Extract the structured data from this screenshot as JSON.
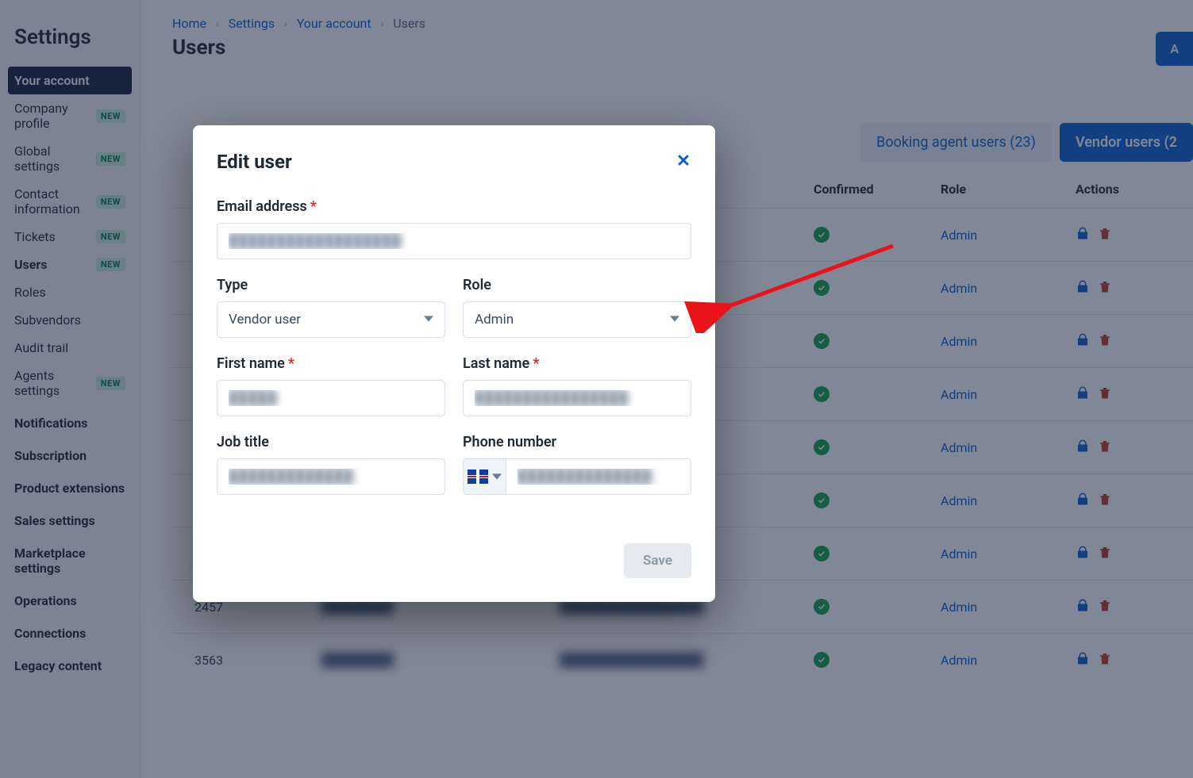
{
  "sidebar": {
    "title": "Settings",
    "active_group_label": "Your account",
    "items": [
      {
        "label": "Company profile",
        "new": true,
        "bold": false
      },
      {
        "label": "Global settings",
        "new": true,
        "bold": false
      },
      {
        "label": "Contact information",
        "new": true,
        "bold": false
      },
      {
        "label": "Tickets",
        "new": true,
        "bold": false
      },
      {
        "label": "Users",
        "new": true,
        "bold": true
      },
      {
        "label": "Roles",
        "new": false,
        "bold": false
      },
      {
        "label": "Subvendors",
        "new": false,
        "bold": false
      },
      {
        "label": "Audit trail",
        "new": false,
        "bold": false
      },
      {
        "label": "Agents settings",
        "new": true,
        "bold": false
      }
    ],
    "groups": [
      "Notifications",
      "Subscription",
      "Product extensions",
      "Sales settings",
      "Marketplace settings",
      "Operations",
      "Connections",
      "Legacy content"
    ],
    "new_badge_text": "NEW"
  },
  "breadcrumb": {
    "items": [
      "Home",
      "Settings",
      "Your account",
      "Users"
    ]
  },
  "page": {
    "title": "Users",
    "add_button": "A",
    "tabs": {
      "booking_agent": "Booking agent users (23)",
      "vendor": "Vendor users (2"
    }
  },
  "table": {
    "headers": {
      "id": "",
      "name": "",
      "email": "",
      "confirmed": "Confirmed",
      "role": "Role",
      "actions": "Actions"
    },
    "role_label": "Admin",
    "rows": [
      {
        "id": "",
        "name": "████████",
        "email": "████████████████"
      },
      {
        "id": "",
        "name": "████████",
        "email": "████████████████"
      },
      {
        "id": "",
        "name": "████████",
        "email": "████████████████"
      },
      {
        "id": "",
        "name": "████████",
        "email": "████████████████"
      },
      {
        "id": "",
        "name": "████████",
        "email": "████████████████"
      },
      {
        "id": "",
        "name": "████████",
        "email": "████████████████"
      },
      {
        "id": "",
        "name": "████████",
        "email": "████████████████"
      },
      {
        "id": "2457",
        "name": "████████",
        "email": "████████████████"
      },
      {
        "id": "3563",
        "name": "████████",
        "email": "████████████████"
      }
    ]
  },
  "dialog": {
    "title": "Edit user",
    "labels": {
      "email": "Email address",
      "type": "Type",
      "role": "Role",
      "first_name": "First name",
      "last_name": "Last name",
      "job_title": "Job title",
      "phone": "Phone number"
    },
    "values": {
      "email": "██████████████████",
      "type": "Vendor user",
      "role": "Admin",
      "first_name": "█████",
      "last_name": "████████████████",
      "job_title": "█████████████",
      "phone": "██████████████"
    },
    "save": "Save"
  }
}
